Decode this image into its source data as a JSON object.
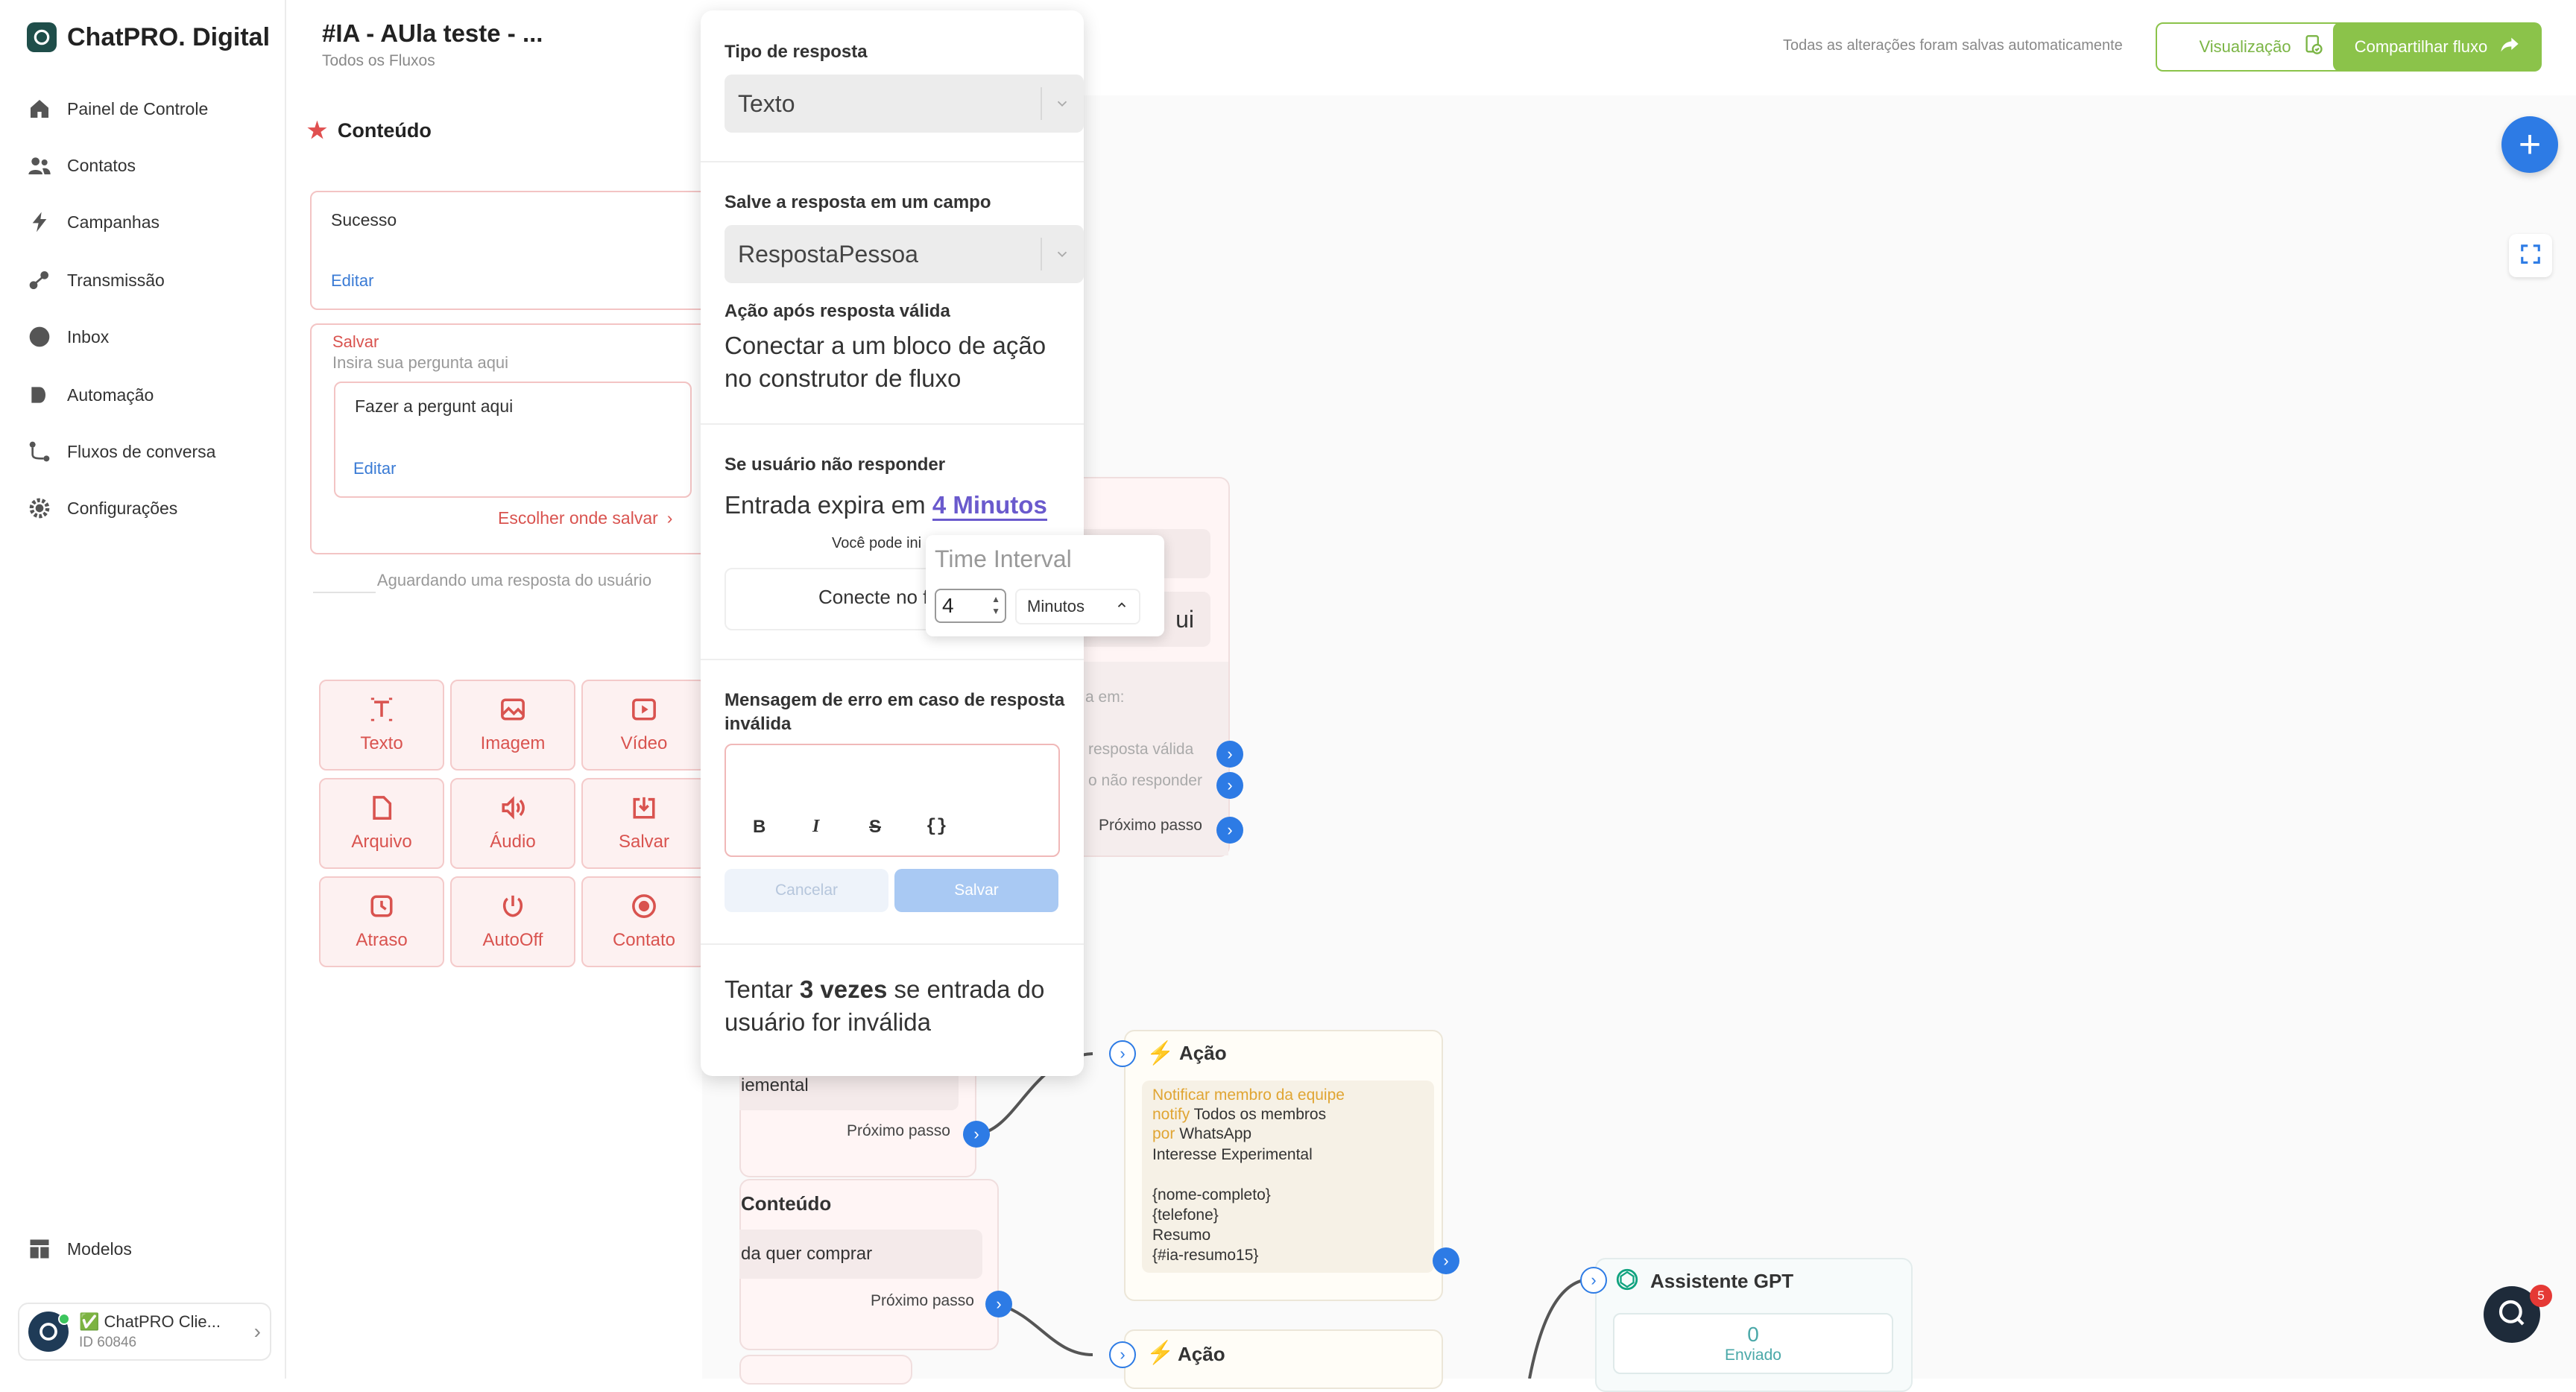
{
  "sidebar": {
    "brand": "ChatPRO. Digital",
    "items": [
      {
        "label": "Painel de Controle",
        "icon": "home-icon"
      },
      {
        "label": "Contatos",
        "icon": "users-icon"
      },
      {
        "label": "Campanhas",
        "icon": "bolt-icon"
      },
      {
        "label": "Transmissão",
        "icon": "broadcast-icon"
      },
      {
        "label": "Inbox",
        "icon": "chat-icon"
      },
      {
        "label": "Automação",
        "icon": "play-icon"
      },
      {
        "label": "Fluxos de conversa",
        "icon": "flow-icon"
      },
      {
        "label": "Configurações",
        "icon": "gear-icon"
      }
    ],
    "models_label": "Modelos",
    "account": {
      "name": "✅ ChatPRO Clie...",
      "id": "ID 60846"
    }
  },
  "header": {
    "title": "#IA - AUla teste - ...",
    "breadcrumb": "Todos os Fluxos",
    "autosave": "Todas as alterações foram salvas automaticamente",
    "preview_label": "Visualização",
    "share_label": "Compartilhar fluxo"
  },
  "content_panel": {
    "title": "Conteúdo",
    "sucesso": {
      "text": "Sucesso",
      "edit": "Editar"
    },
    "salvar": {
      "title": "Salvar",
      "placeholder": "Insira sua pergunta aqui",
      "question": "Fazer a pergunt aqui",
      "edit": "Editar",
      "choose": "Escolher onde salvar"
    },
    "waiting": "Aguardando uma resposta do usuário",
    "tools": [
      {
        "label": "Texto",
        "icon": "text-icon"
      },
      {
        "label": "Imagem",
        "icon": "image-icon"
      },
      {
        "label": "Vídeo",
        "icon": "video-icon"
      },
      {
        "label": "Arquivo",
        "icon": "file-icon"
      },
      {
        "label": "Áudio",
        "icon": "audio-icon"
      },
      {
        "label": "Salvar",
        "icon": "save-icon"
      },
      {
        "label": "Atraso",
        "icon": "clock-icon"
      },
      {
        "label": "AutoOff",
        "icon": "power-icon"
      },
      {
        "label": "Contato",
        "icon": "contact-icon"
      }
    ]
  },
  "popup": {
    "response_type_label": "Tipo de resposta",
    "response_type_value": "Texto",
    "save_field_label": "Salve a resposta em um campo",
    "save_field_value": "RespostaPessoa",
    "action_label": "Ação após resposta válida",
    "action_text": "Conectar a um bloco de ação no construtor de fluxo",
    "no_reply_label": "Se usuário não responder",
    "expires_prefix": "Entrada expira em",
    "expires_value": "4 Minutos",
    "can_text": "Você pode ini",
    "connect_text": "Conecte no f",
    "error_label": "Mensagem de erro em caso de resposta inválida",
    "format_buttons": [
      "B",
      "I",
      "S",
      "{}"
    ],
    "cancel_label": "Cancelar",
    "save_label": "Salvar",
    "retry_prefix": "Tentar",
    "retry_value": "3 vezes",
    "retry_suffix": "se entrada do usuário for inválida"
  },
  "time_interval": {
    "placeholder": "Time Interval",
    "value": "4",
    "unit": "Minutos"
  },
  "nodes": {
    "behind_popup": {
      "ui_fragment": "ui",
      "em_label": "a em:",
      "valid": "resposta válida",
      "no_reply": "o não responder",
      "next": "Próximo passo"
    },
    "experimental": {
      "text": "iemental",
      "next": "Próximo passo"
    },
    "conteudo2": {
      "title": "Conteúdo",
      "text": "da quer comprar",
      "next": "Próximo passo"
    },
    "acao1": {
      "title": "Ação",
      "notify_heading": "Notificar membro da equipe",
      "notify_label": "notify",
      "notify_value": "Todos os membros",
      "por_label": "por",
      "por_value": "WhatsApp",
      "lines": [
        "Interesse Experimental",
        "",
        "{nome-completo}",
        "{telefone}",
        "Resumo",
        "{#ia-resumo15}"
      ]
    },
    "acao2": {
      "title": "Ação"
    },
    "gpt": {
      "title": "Assistente GPT",
      "count": "0",
      "count_label": "Enviado"
    }
  },
  "chat_widget": {
    "badge": "5"
  },
  "colors": {
    "accent": "#2d7be5",
    "green": "#8bc34a",
    "danger": "#d9534f"
  }
}
